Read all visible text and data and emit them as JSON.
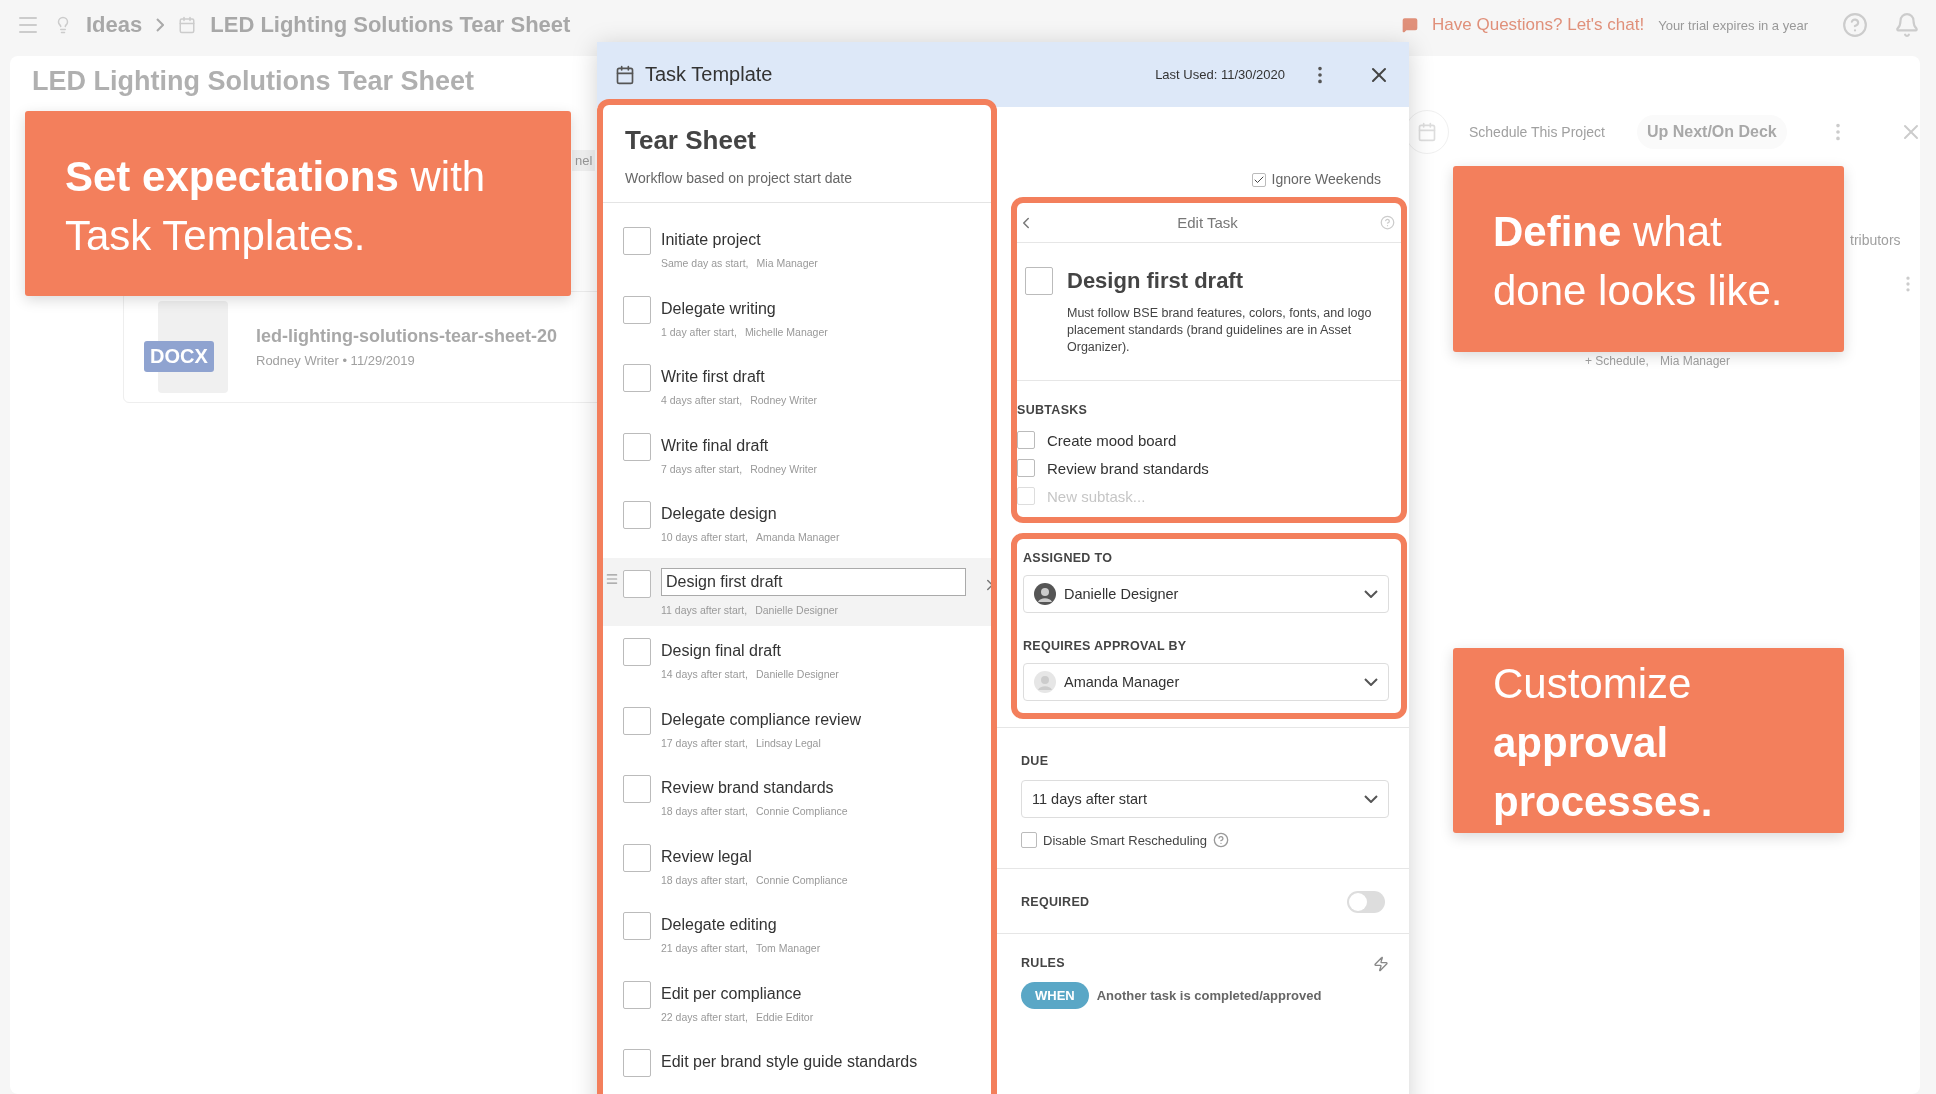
{
  "top_bar": {
    "breadcrumbs": [
      {
        "label": "Ideas"
      },
      {
        "label": "LED Lighting Solutions Tear Sheet"
      }
    ],
    "chat_link": "Have Questions? Let's chat!",
    "trial_note": "Your trial expires in a year"
  },
  "project": {
    "title": "LED Lighting Solutions Tear Sheet",
    "tab_fragment": "nel",
    "file": {
      "badge": "DOCX",
      "name": "led-lighting-solutions-tear-sheet-20",
      "meta": "Rodney Writer • 11/29/2019"
    },
    "schedule_label": "Schedule This Project",
    "status": "Up Next/On Deck",
    "column_fragment": "tributors",
    "task_schedule": "+ Schedule,",
    "task_assignee": "Mia Manager"
  },
  "modal": {
    "title": "Task Template",
    "last_used": "Last Used: 11/30/2020",
    "template": {
      "name": "Tear Sheet",
      "subtitle": "Workflow based on project start date"
    },
    "tasks": [
      {
        "name": "Initiate project",
        "due": "Same day as start,",
        "assignee": "Mia Manager",
        "selected": false
      },
      {
        "name": "Delegate writing",
        "due": "1 day after start,",
        "assignee": "Michelle Manager",
        "selected": false
      },
      {
        "name": "Write first draft",
        "due": "4 days after start,",
        "assignee": "Rodney Writer",
        "selected": false
      },
      {
        "name": "Write final draft",
        "due": "7 days after start,",
        "assignee": "Rodney Writer",
        "selected": false
      },
      {
        "name": "Delegate design",
        "due": "10 days after start,",
        "assignee": "Amanda Manager",
        "selected": false
      },
      {
        "name": "Design first draft",
        "due": "11 days after start,",
        "assignee": "Danielle Designer",
        "selected": true
      },
      {
        "name": "Design final draft",
        "due": "14 days after start,",
        "assignee": "Danielle Designer",
        "selected": false
      },
      {
        "name": "Delegate compliance review",
        "due": "17 days after start,",
        "assignee": "Lindsay Legal",
        "selected": false
      },
      {
        "name": "Review brand standards",
        "due": "18 days after start,",
        "assignee": "Connie Compliance",
        "selected": false
      },
      {
        "name": "Review legal",
        "due": "18 days after start,",
        "assignee": "Connie Compliance",
        "selected": false
      },
      {
        "name": "Delegate editing",
        "due": "21 days after start,",
        "assignee": "Tom Manager",
        "selected": false
      },
      {
        "name": "Edit per compliance",
        "due": "22 days after start,",
        "assignee": "Eddie Editor",
        "selected": false
      },
      {
        "name": "Edit per brand style guide standards",
        "selected": false
      }
    ],
    "ignore_weekends": {
      "label": "Ignore Weekends",
      "checked": true
    },
    "edit_task": {
      "heading": "Edit Task",
      "name": "Design first draft",
      "checked": false,
      "description": "Must follow BSE brand features, colors, fonts, and logo placement standards (brand guidelines are in Asset Organizer).",
      "subtasks_label": "SUBTASKS",
      "subtasks": [
        {
          "label": "Create mood board",
          "checked": false
        },
        {
          "label": "Review brand standards",
          "checked": false
        }
      ],
      "new_subtask": {
        "placeholder": "New subtask...",
        "checked": false
      }
    },
    "assigned_to": {
      "label": "ASSIGNED TO",
      "value": "Danielle Designer"
    },
    "approval": {
      "label": "REQUIRES APPROVAL BY",
      "value": "Amanda Manager"
    },
    "due": {
      "label": "DUE",
      "value": "11 days after start"
    },
    "smart_rescheduling": {
      "label": "Disable Smart Rescheduling",
      "checked": false
    },
    "required": {
      "label": "REQUIRED",
      "on": false
    },
    "rules": {
      "label": "RULES",
      "when_badge": "WHEN",
      "condition": "Another task is completed/approved"
    }
  },
  "callouts": [
    {
      "text": "**Set expectations** with Task Templates."
    },
    {
      "text": "**Define** what done looks like."
    },
    {
      "text": "Customize **approval processes.**"
    }
  ]
}
